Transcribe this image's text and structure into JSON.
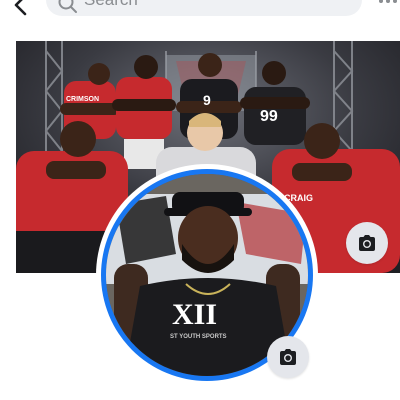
{
  "header": {
    "search_placeholder": "Search"
  },
  "cover_photo": {
    "jersey_numbers": [
      "9",
      "99"
    ],
    "jersey_text": [
      "CRAIG",
      "CRIMSON"
    ]
  },
  "profile_photo": {
    "shirt_text": "XII",
    "shirt_subtext": "ST YOUTH SPORTS"
  },
  "colors": {
    "accent": "#1877f2",
    "jersey_red": "#c62a2e",
    "search_bg": "#eff1f4",
    "camera_button_bg": "#e4e6eb"
  }
}
